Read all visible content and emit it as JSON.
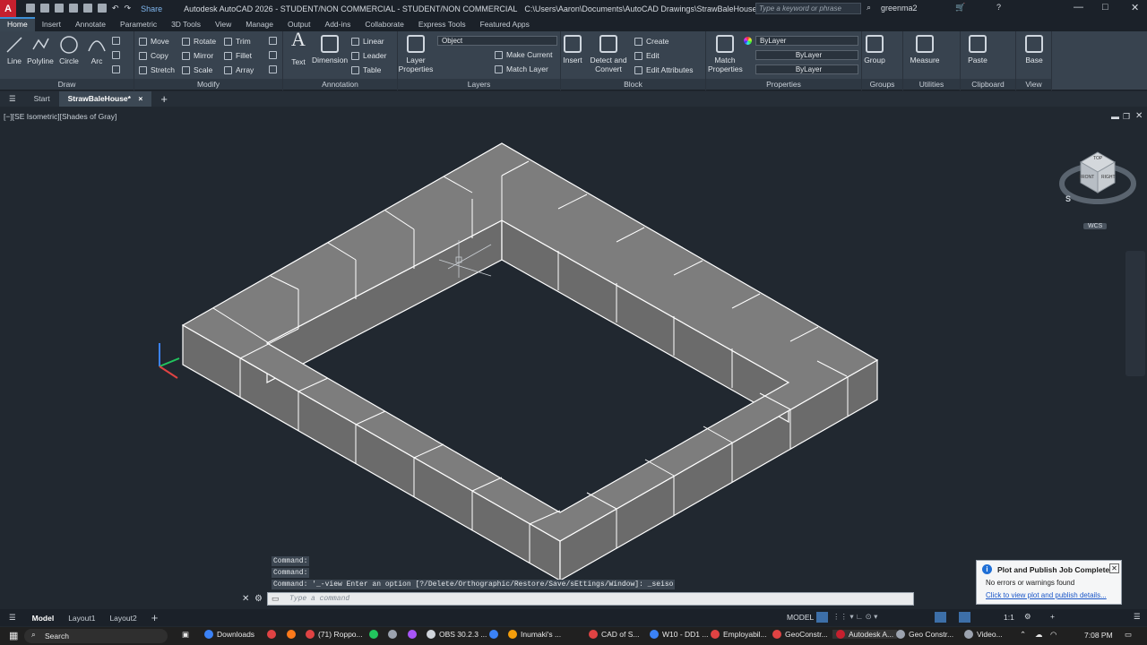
{
  "titlebar": {
    "logo": "A",
    "share": "Share",
    "title": "Autodesk AutoCAD 2026 - STUDENT/NON COMMERCIAL - STUDENT/NON COMMERCIAL",
    "path": "C:\\Users\\Aaron\\Documents\\AutoCAD Drawings\\StrawBaleHouse.dwg",
    "search_placeholder": "Type a keyword or phrase",
    "user": "greenma2"
  },
  "ribbon_tabs": [
    "Home",
    "Insert",
    "Annotate",
    "Parametric",
    "3D Tools",
    "View",
    "Manage",
    "Output",
    "Add-ins",
    "Collaborate",
    "Express Tools",
    "Featured Apps"
  ],
  "ribbon": {
    "draw": {
      "title": "Draw",
      "line": "Line",
      "polyline": "Polyline",
      "circle": "Circle",
      "arc": "Arc"
    },
    "modify": {
      "title": "Modify",
      "move": "Move",
      "rotate": "Rotate",
      "trim": "Trim",
      "copy": "Copy",
      "mirror": "Mirror",
      "fillet": "Fillet",
      "stretch": "Stretch",
      "scale": "Scale",
      "array": "Array"
    },
    "annotation": {
      "title": "Annotation",
      "text": "Text",
      "dimension": "Dimension",
      "linear": "Linear",
      "leader": "Leader",
      "table": "Table"
    },
    "layers": {
      "title": "Layers",
      "layer_properties": "Layer Properties",
      "current_layer": "Object",
      "make_current": "Make Current",
      "match_layer": "Match Layer"
    },
    "block": {
      "title": "Block",
      "insert": "Insert",
      "detect": "Detect and Convert",
      "create": "Create",
      "edit": "Edit",
      "edit_attributes": "Edit Attributes"
    },
    "properties": {
      "title": "Properties",
      "match": "Match Properties",
      "color": "ByLayer",
      "linetype": "ByLayer",
      "lineweight": "ByLayer"
    },
    "groups": {
      "title": "Groups",
      "group": "Group"
    },
    "utilities": {
      "title": "Utilities",
      "measure": "Measure"
    },
    "clipboard": {
      "title": "Clipboard",
      "paste": "Paste"
    },
    "view": {
      "title": "View",
      "base": "Base"
    }
  },
  "doc_tabs": {
    "start": "Start",
    "active": "StrawBaleHouse*"
  },
  "viewport": {
    "label": "[−][SE Isometric][Shades of Gray]"
  },
  "viewcube": {
    "top": "TOP",
    "front": "FRONT",
    "right": "RIGHT",
    "compass": "S",
    "wcs": "WCS"
  },
  "command": {
    "history": [
      "Command:",
      "Command:",
      "Command: '_-view Enter an option [?/Delete/Orthographic/Restore/Save/sEttings/Window]: _seiso"
    ],
    "placeholder": "Type a command"
  },
  "status": {
    "model": "Model",
    "layout1": "Layout1",
    "layout2": "Layout2",
    "space": "MODEL",
    "scale": "1:1"
  },
  "notification": {
    "title": "Plot and Publish Job Complete",
    "body": "No errors or warnings found",
    "link": "Click to view plot and publish details..."
  },
  "taskbar": {
    "search": "Search",
    "apps": [
      {
        "label": "Downloads",
        "color": "#3b82f6"
      },
      {
        "label": "",
        "color": "#e04343"
      },
      {
        "label": "",
        "color": "#ff7a1a"
      },
      {
        "label": "(71) Roppo...",
        "color": "#e04343"
      },
      {
        "label": "",
        "color": "#22c55e"
      },
      {
        "label": "",
        "color": "#9ca3af"
      },
      {
        "label": "",
        "color": "#a855f7"
      },
      {
        "label": "OBS 30.2.3 ...",
        "color": "#d1d5db"
      },
      {
        "label": "",
        "color": "#3b82f6"
      },
      {
        "label": "Inumaki's ...",
        "color": "#f59e0b"
      },
      {
        "label": "CAD of S...",
        "color": "#e04343"
      },
      {
        "label": "W10 - DD1 ...",
        "color": "#3b82f6"
      },
      {
        "label": "Employabil...",
        "color": "#e04343"
      },
      {
        "label": "GeoConstr...",
        "color": "#e04343"
      },
      {
        "label": "Autodesk A...",
        "color": "#c6202e"
      },
      {
        "label": "Geo Constr...",
        "color": "#9ca3af"
      },
      {
        "label": "Video...",
        "color": "#9ca3af"
      }
    ],
    "time": "7:08 PM"
  }
}
